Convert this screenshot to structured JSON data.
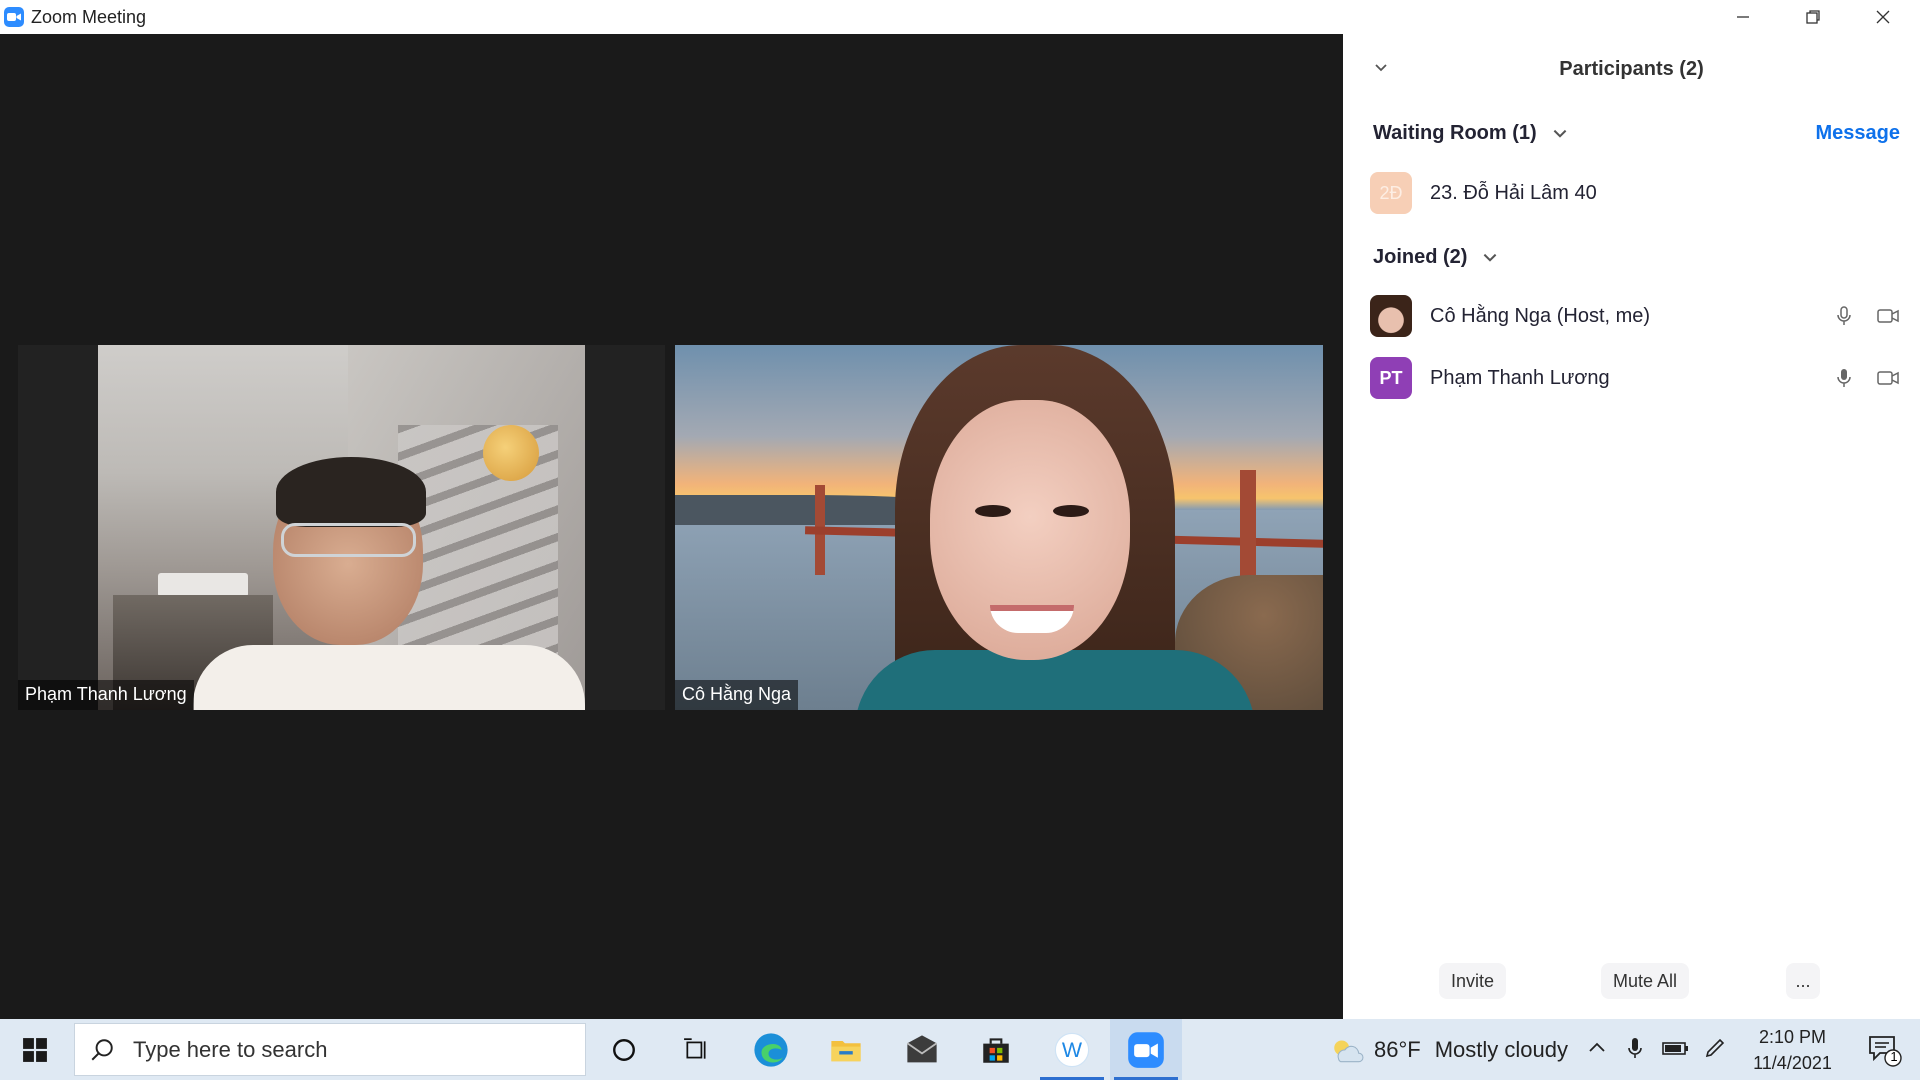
{
  "window": {
    "title": "Zoom Meeting",
    "controls": [
      "minimize",
      "restore",
      "close"
    ]
  },
  "video": {
    "tiles": [
      {
        "name": "Phạm Thanh Lương"
      },
      {
        "name": "Cô Hằng Nga"
      }
    ]
  },
  "participants": {
    "title": "Participants (2)",
    "waiting_room": {
      "label": "Waiting Room (1)",
      "message_label": "Message",
      "items": [
        {
          "initials": "2Đ",
          "name": "23. Đỗ Hải Lâm 40",
          "avatar_color": "#f7cfb6"
        }
      ]
    },
    "joined": {
      "label": "Joined (2)",
      "items": [
        {
          "initials": "",
          "name": "Cô Hằng Nga (Host, me)",
          "avatar": "photo"
        },
        {
          "initials": "PT",
          "name": "Phạm Thanh Lương",
          "avatar_color": "#8f3fb5"
        }
      ]
    },
    "footer": {
      "invite_label": "Invite",
      "mute_all_label": "Mute All",
      "more_label": "..."
    }
  },
  "taskbar": {
    "search_placeholder": "Type here to search",
    "weather": {
      "temp": "86°F",
      "condition": "Mostly cloudy"
    },
    "clock": {
      "time": "2:10 PM",
      "date": "11/4/2021"
    },
    "notifications_count": "1"
  },
  "colors": {
    "accent": "#0e71eb",
    "zoom_blue": "#2d8cff",
    "video_bg": "#1a1a1a"
  }
}
